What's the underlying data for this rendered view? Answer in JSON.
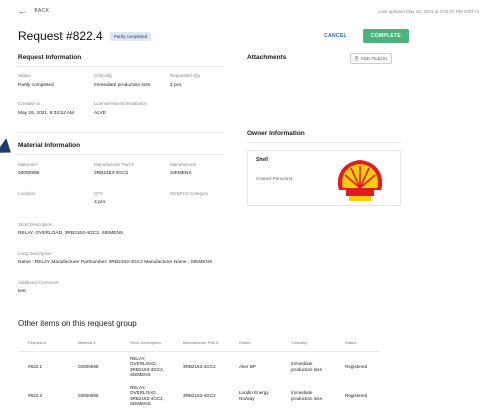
{
  "topbar": {
    "back_label": "BACK",
    "last_updated": "Last updated May 26, 2021 at 4:32:07 PM GMT+3"
  },
  "header": {
    "title": "Request #822.4",
    "status_badge": "Partly completed",
    "cancel_label": "CANCEL",
    "complete_label": "COMPLETE"
  },
  "request_information": {
    "heading": "Request Information",
    "status": {
      "label": "Status",
      "value": "Partly completed"
    },
    "criticality": {
      "label": "Criticality",
      "value": "Immediate production loss"
    },
    "requested_qty": {
      "label": "Requested Qty",
      "value": "3 pcs"
    },
    "created_on": {
      "label": "Created on",
      "value": "May 26, 2021, 9:34:52 AM"
    },
    "license": {
      "label": "License/Assets/Installation",
      "value": "ALVE"
    }
  },
  "attachments": {
    "heading": "Attachments",
    "add_files_label": "ADD FILE(S)"
  },
  "owner_information": {
    "heading": "Owner Information",
    "owner_name": "Shell",
    "contact_label": "Contact Person(s):"
  },
  "material_information": {
    "heading": "Material Information",
    "material_no": {
      "label": "Material #",
      "value": "03000596"
    },
    "manufacturer_part": {
      "label": "Manufacturer Part #",
      "value": "3RB2163-4GC2"
    },
    "manufacturer": {
      "label": "Manufacturer",
      "value": "SIEMENS"
    },
    "location": {
      "label": "Location",
      "value": ""
    },
    "qty": {
      "label": "QTY",
      "value": "3 pcs"
    },
    "unspsc": {
      "label": "UNSPCS Category",
      "value": ""
    },
    "short_description": {
      "label": "Short Description",
      "value": "RELAY, OVERLOAD, 3RB2163-4GC2, SIEMENS"
    },
    "long_description": {
      "label": "Long Description",
      "value": "Name : RELAY  Manufacturer Partnumber: 3RB2163-4GC2  Manufacturer Name : SIEMENS"
    },
    "additional_comment": {
      "label": "Additional Comment",
      "value": "test"
    }
  },
  "other_items": {
    "heading": "Other items on this request group",
    "columns": [
      "Request #",
      "Material #",
      "Short Description",
      "Manufacturer Part #",
      "Owner",
      "Criticality",
      "Status"
    ],
    "rows": [
      [
        "#822.1",
        "03000596",
        "RELAY, OVERLOAD, 3RB2163-4GC2, SIEMENS",
        "3RB2163-4GC2",
        "Aker BP",
        "Immediate production loss",
        "Registered"
      ],
      [
        "#822.3",
        "03000596",
        "RELAY, OVERLOAD, 3RB2163-4GC2, SIEMENS",
        "3RB2163-4GC2",
        "Lundin Energy Norway",
        "Immediate production loss",
        "Registered"
      ]
    ]
  },
  "colors": {
    "complete_button": "#4bb37e",
    "cancel_link": "#2e62b5",
    "badge_bg": "#dfe6f3",
    "shell_red": "#dd1d21",
    "shell_yellow": "#fbce07"
  }
}
